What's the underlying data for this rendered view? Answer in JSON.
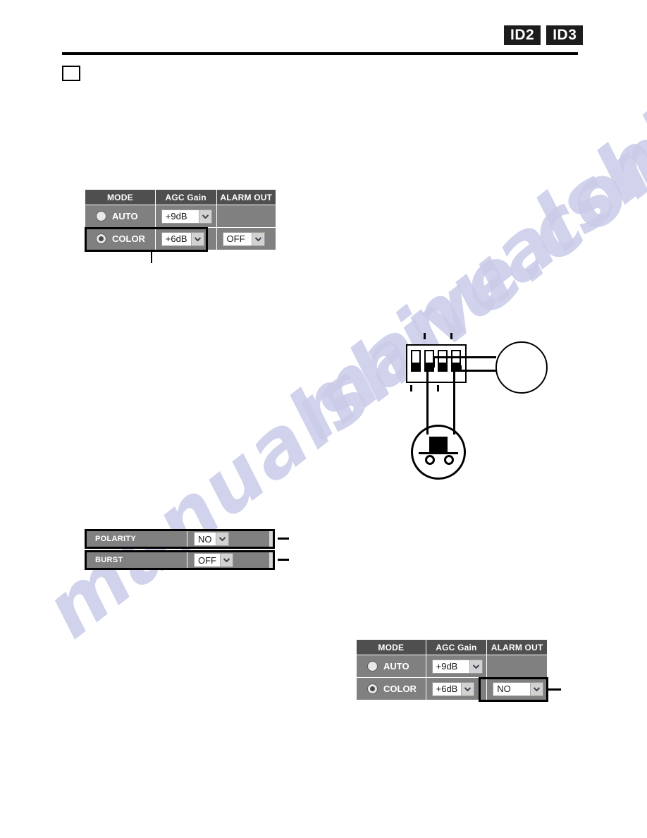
{
  "page": {
    "id_badges": [
      "ID2",
      "ID3"
    ],
    "watermark": "manualshive.com"
  },
  "tables": [
    {
      "name": "settings-table-top",
      "headers": [
        "MODE",
        "AGC Gain",
        "ALARM OUT"
      ],
      "rows": [
        {
          "mode_label": "AUTO",
          "mode_selected": false,
          "agc_gain": "+9dB",
          "alarm_out": ""
        },
        {
          "mode_label": "COLOR",
          "mode_selected": true,
          "agc_gain": "+6dB",
          "alarm_out": "OFF"
        }
      ]
    },
    {
      "name": "settings-table-bottom",
      "headers": [
        "MODE",
        "AGC Gain",
        "ALARM OUT"
      ],
      "rows": [
        {
          "mode_label": "AUTO",
          "mode_selected": false,
          "agc_gain": "+9dB",
          "alarm_out": ""
        },
        {
          "mode_label": "COLOR",
          "mode_selected": true,
          "agc_gain": "+6dB",
          "alarm_out": "NO"
        }
      ]
    }
  ],
  "bars": [
    {
      "label": "POLARITY",
      "value": "NO"
    },
    {
      "label": "BURST",
      "value": "OFF"
    }
  ],
  "icons": {
    "chevron_down": "chevron-down-icon",
    "dip_switch": "dip-switch-icon",
    "connector": "connector-plug-icon"
  }
}
